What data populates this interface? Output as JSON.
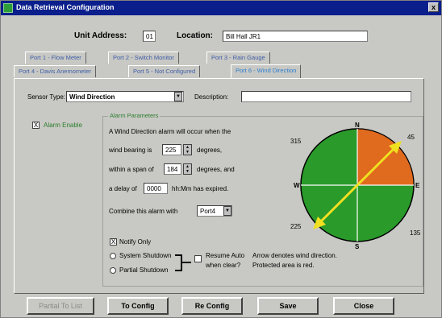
{
  "window": {
    "title": "Data Retrieval Configuration",
    "close_label": "x"
  },
  "header": {
    "unit_address_label": "Unit Address:",
    "unit_address_value": "01",
    "location_label": "Location:",
    "location_value": "Bill Hall JR1"
  },
  "tabs": [
    {
      "label": "Port 1 - Flow Meter"
    },
    {
      "label": "Port 2 - Switch Monitor"
    },
    {
      "label": "Port 3 - Rain Gauge"
    },
    {
      "label": "Port 4 - Davis Anemometer"
    },
    {
      "label": "Port 5 - Not Configured"
    },
    {
      "label": "Port 6 - Wind Direction"
    }
  ],
  "sensor": {
    "type_label": "Sensor Type:",
    "type_value": "Wind Direction",
    "description_label": "Description:",
    "description_value": ""
  },
  "alarm": {
    "enable_label": "Alarm Enable",
    "enable_checked": "X",
    "params_title": "Alarm Parameters",
    "line1": "A Wind Direction alarm will occur when the",
    "bearing_prefix": "wind bearing is",
    "bearing_value": "225",
    "bearing_suffix": "degrees,",
    "span_prefix": "within a span of",
    "span_value": "184",
    "span_suffix": "degrees, and",
    "delay_prefix": "a delay of",
    "delay_value": "0000",
    "delay_suffix": "hh:Mm has expired.",
    "combine_label": "Combine this alarm with",
    "combine_value": "Port4",
    "notify_label": "Notify Only",
    "notify_checked": "X",
    "system_shutdown_label": "System Shutdown",
    "partial_shutdown_label": "Partial Shutdown",
    "resume_label": "Resume Auto",
    "resume_label2": "when clear?",
    "note_line1": "Arrow denotes wind direction.",
    "note_line2": "Protected area is red."
  },
  "compass": {
    "labels": {
      "n": "N",
      "e": "E",
      "s": "S",
      "w": "W",
      "d45": "45",
      "d135": "135",
      "d225": "225",
      "d315": "315"
    },
    "colors": {
      "background": "#2a9a2a",
      "protected": "#e06a1e",
      "arrow": "#f0e020"
    }
  },
  "buttons": {
    "partial_list": "Partial To List",
    "to_config": "To Config",
    "re_config": "Re Config",
    "save": "Save",
    "close": "Close"
  }
}
